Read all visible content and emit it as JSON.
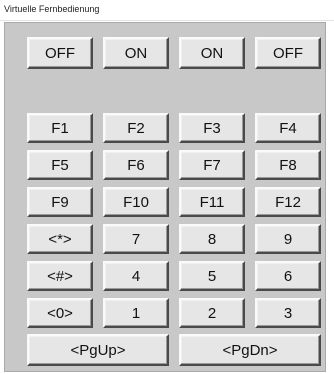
{
  "window": {
    "title": "Virtuelle Fernbedienung"
  },
  "power_row": [
    "OFF",
    "ON",
    "ON",
    "OFF"
  ],
  "keypad_rows": [
    [
      "F1",
      "F2",
      "F3",
      "F4"
    ],
    [
      "F5",
      "F6",
      "F7",
      "F8"
    ],
    [
      "F9",
      "F10",
      "F11",
      "F12"
    ],
    [
      "<*>",
      "7",
      "8",
      "9"
    ],
    [
      "<#>",
      "4",
      "5",
      "6"
    ],
    [
      "<0>",
      "1",
      "2",
      "3"
    ]
  ],
  "paging": {
    "page_up": "<PgUp>",
    "page_down": "<PgDn>"
  }
}
